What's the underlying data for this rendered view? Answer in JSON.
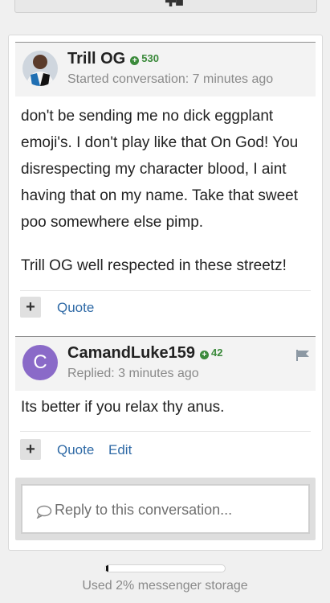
{
  "conversation": {
    "first_message": {
      "author": "Trill OG",
      "reputation": "530",
      "meta": "Started conversation: 7 minutes ago",
      "paragraphs": [
        "don't be sending me no dick eggplant emoji's. I don't play like that On God! You disrespecting my character blood, I aint having that on my name. Take that sweet poo somewhere else pimp.",
        "Trill OG well respected in these streetz!"
      ],
      "actions": {
        "plus": "+",
        "quote": "Quote"
      }
    },
    "reply": {
      "author": "CamandLuke159",
      "avatar_letter": "C",
      "reputation": "42",
      "meta": "Replied: 3 minutes ago",
      "paragraphs": [
        "Its better if you relax thy anus."
      ],
      "actions": {
        "plus": "+",
        "quote": "Quote",
        "edit": "Edit"
      }
    },
    "reply_box": {
      "placeholder": "Reply to this conversation..."
    }
  },
  "storage": {
    "used_fraction": 0.02,
    "text": "Used 2% messenger storage"
  },
  "colors": {
    "link": "#2f6aa6",
    "reputation": "#3b8a3b",
    "avatar_c": "#8a6ac8"
  },
  "icons": [
    "plus-icon",
    "user-icon",
    "flag-icon",
    "speech-bubble-icon",
    "reputation-plus-icon"
  ]
}
